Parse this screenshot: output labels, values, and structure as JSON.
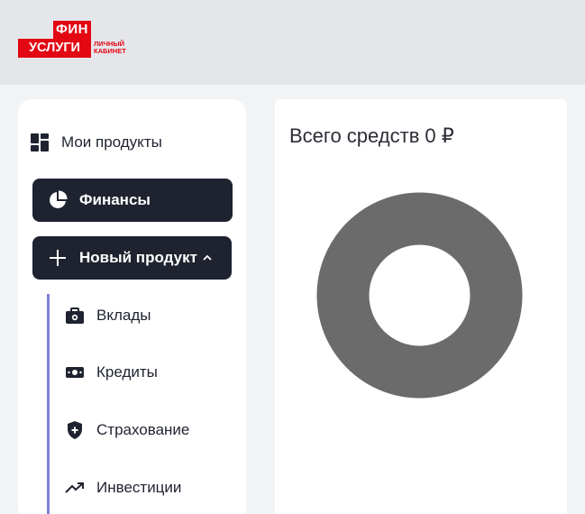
{
  "header": {
    "logo": {
      "top": "ФИН",
      "bottom": "УСЛУГИ",
      "sub_line1": "ЛИЧНЫЙ",
      "sub_line2": "КАБИНЕТ"
    }
  },
  "sidebar": {
    "my_products": {
      "label": "Мои продукты",
      "icon": "grid-icon"
    },
    "finances": {
      "label": "Финансы",
      "icon": "pie-chart-icon",
      "active": true
    },
    "new_product": {
      "label": "Новый продукт",
      "icon": "plus-icon",
      "expanded": true
    },
    "sub_items": [
      {
        "label": "Вклады",
        "icon": "briefcase-icon"
      },
      {
        "label": "Кредиты",
        "icon": "cash-icon"
      },
      {
        "label": "Страхование",
        "icon": "shield-plus-icon"
      },
      {
        "label": "Инвестиции",
        "icon": "trending-up-icon"
      }
    ]
  },
  "panel": {
    "title": "Всего средств",
    "amount": "0 ₽",
    "donut_color": "#6b6b6b"
  },
  "colors": {
    "accent": "#e30613",
    "dark": "#1f2330",
    "sub_line": "#7b82d6"
  }
}
